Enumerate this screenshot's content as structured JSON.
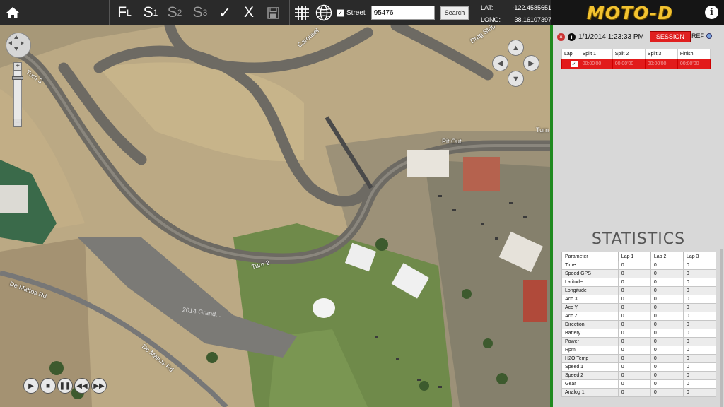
{
  "toolbar": {
    "home_icon": "home-icon",
    "fl_label": "F",
    "fl_sub": "L",
    "s1_label": "S",
    "s1_sub": "1",
    "s2_label": "S",
    "s2_sub": "2",
    "s3_label": "S",
    "s3_sub": "3",
    "confirm_glyph": "✓",
    "cancel_glyph": "X",
    "save_icon": "save-icon",
    "grid_icon": "grid-icon",
    "globe_icon": "globe-icon",
    "street_label": "Street",
    "street_checked": true,
    "search_value": "95476",
    "search_button": "Search",
    "lat_label": "LAT:",
    "lat_value": "-122.4585651",
    "long_label": "LONG:",
    "long_value": "38.16107397"
  },
  "brand": {
    "logo_text": "MOTO-D",
    "info_glyph": "i"
  },
  "map": {
    "labels": {
      "turn3": "Turn 3",
      "carousel": "Carousel",
      "drag_strip": "Drag Strip",
      "pit_out": "Pit Out",
      "turn_right": "Turn",
      "turn2": "Turn 2",
      "de_mattos_1": "De Mattos Rd",
      "de_mattos_2": "De Mattos Rd",
      "grandstand": "2014 Grand..."
    }
  },
  "session": {
    "datetime": "1/1/2014 1:23:33 PM",
    "session_button": "SESSION",
    "ref_label": "REF",
    "close_glyph": "×",
    "info_glyph": "i",
    "lap_headers": [
      "Lap",
      "Split 1",
      "Split 2",
      "Split 3",
      "Finish"
    ],
    "lap_row": {
      "lap": "",
      "checked": true,
      "split1": "00:00'00",
      "split2": "00:00'00",
      "split3": "00:00'00",
      "finish": "00:00'00"
    }
  },
  "statistics": {
    "title": "STATISTICS",
    "headers": [
      "Parameter",
      "Lap 1",
      "Lap 2",
      "Lap 3"
    ],
    "rows": [
      [
        "Time",
        "0",
        "0",
        "0"
      ],
      [
        "Speed GPS",
        "0",
        "0",
        "0"
      ],
      [
        "Latitude",
        "0",
        "0",
        "0"
      ],
      [
        "Longitude",
        "0",
        "0",
        "0"
      ],
      [
        "Acc X",
        "0",
        "0",
        "0"
      ],
      [
        "Acc Y",
        "0",
        "0",
        "0"
      ],
      [
        "Acc Z",
        "0",
        "0",
        "0"
      ],
      [
        "Direction",
        "0",
        "0",
        "0"
      ],
      [
        "Battery",
        "0",
        "0",
        "0"
      ],
      [
        "Power",
        "0",
        "0",
        "0"
      ],
      [
        "Rpm",
        "0",
        "0",
        "0"
      ],
      [
        "H2O Temp",
        "0",
        "0",
        "0"
      ],
      [
        "Speed 1",
        "0",
        "0",
        "0"
      ],
      [
        "Speed 2",
        "0",
        "0",
        "0"
      ],
      [
        "Gear",
        "0",
        "0",
        "0"
      ],
      [
        "Analog 1",
        "0",
        "0",
        "0"
      ]
    ]
  },
  "colors": {
    "accent_green": "#1f8a1f",
    "session_red": "#e02020",
    "logo_gold": "#f2c230"
  }
}
